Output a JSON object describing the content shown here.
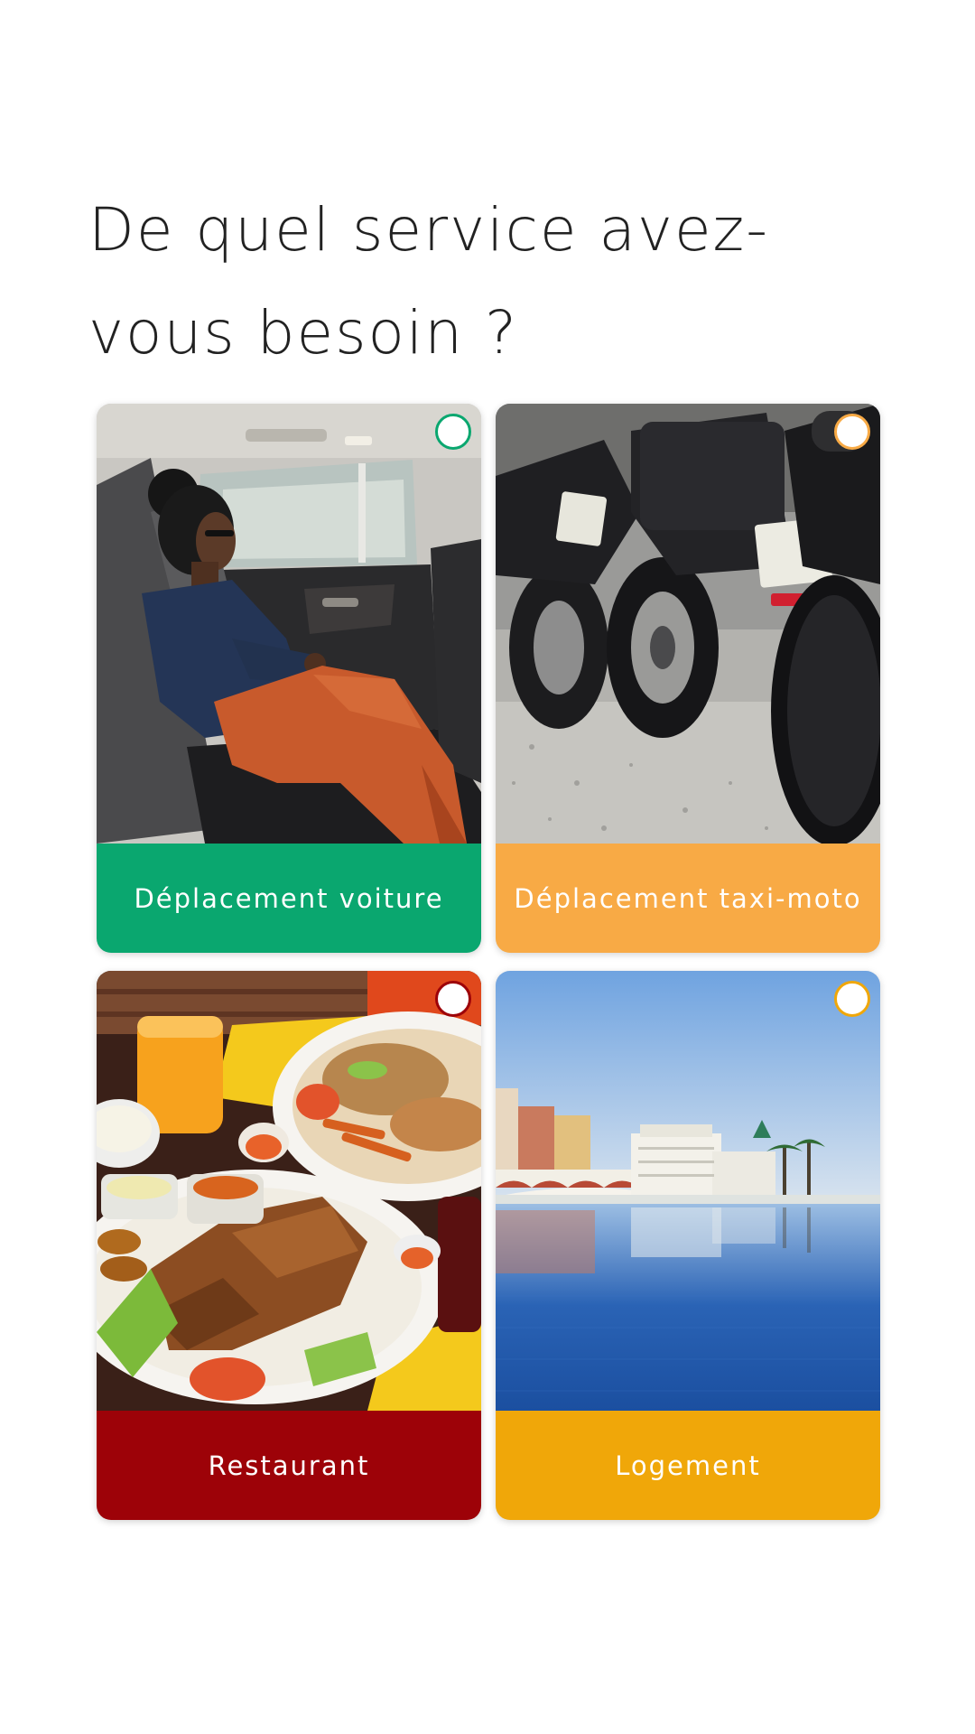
{
  "page": {
    "title": "De quel service avez-vous besoin ?"
  },
  "services": [
    {
      "label": "Déplacement voiture",
      "color": "#0aa76f",
      "image_icon": "car-passenger-photo",
      "selected": false
    },
    {
      "label": "Déplacement taxi-moto",
      "color": "#f8aa45",
      "image_icon": "motorcycles-photo",
      "selected": false
    },
    {
      "label": "Restaurant",
      "color": "#9d0208",
      "image_icon": "grilled-chicken-meal-photo",
      "selected": false
    },
    {
      "label": "Logement",
      "color": "#f0a709",
      "image_icon": "resort-pool-photo",
      "selected": false
    }
  ]
}
